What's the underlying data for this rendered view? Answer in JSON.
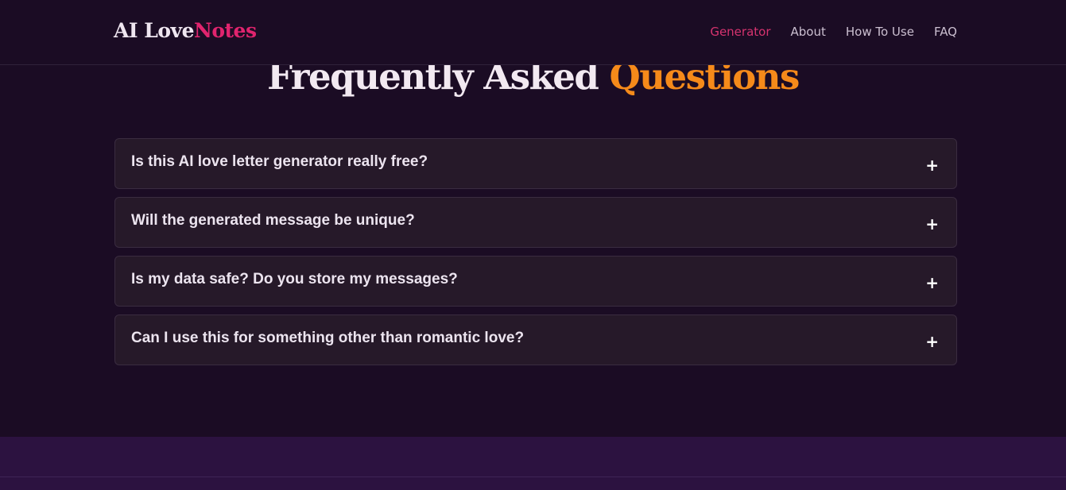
{
  "header": {
    "logo_part1": "AI Love",
    "logo_part2": "Notes",
    "nav": [
      {
        "label": "Generator",
        "active": true
      },
      {
        "label": "About",
        "active": false
      },
      {
        "label": "How To Use",
        "active": false
      },
      {
        "label": "FAQ",
        "active": false
      }
    ]
  },
  "faq": {
    "title_part1": "Frequently Asked ",
    "title_part2": "Questions",
    "toggle_icon": "+",
    "items": [
      {
        "question": "Is this AI love letter generator really free?"
      },
      {
        "question": "Will the generated message be unique?"
      },
      {
        "question": "Is my data safe? Do you store my messages?"
      },
      {
        "question": "Can I use this for something other than romantic love?"
      }
    ]
  },
  "colors": {
    "background": "#1b0c24",
    "brand_pink": "#e0246e",
    "accent_orange": "#f58a1a",
    "card": "#261929",
    "footer": "#2c1240"
  }
}
